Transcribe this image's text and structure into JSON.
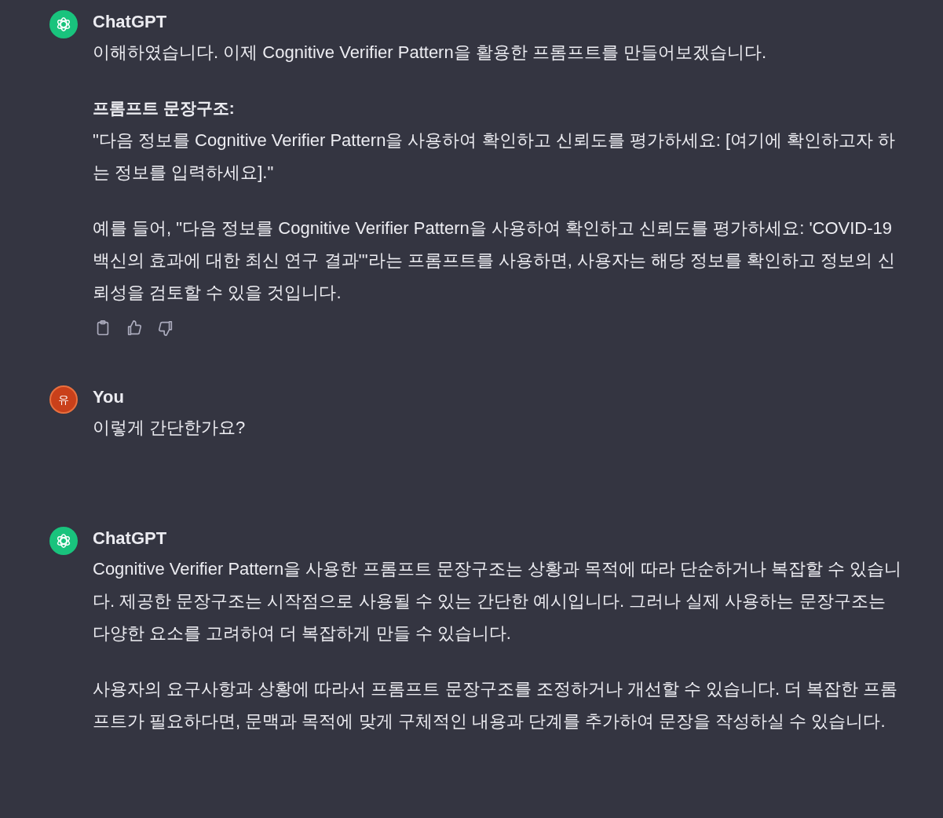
{
  "messages": [
    {
      "kind": "assistant",
      "author": "ChatGPT",
      "has_actions": true,
      "blocks": [
        {
          "kind": "paragraph",
          "text": "이해하였습니다. 이제 Cognitive Verifier Pattern을 활용한 프롬프트를 만들어보겠습니다."
        },
        {
          "kind": "heading_with_text",
          "heading": "프롬프트 문장구조:",
          "text": "\"다음 정보를 Cognitive Verifier Pattern을 사용하여 확인하고 신뢰도를 평가하세요: [여기에 확인하고자 하는 정보를 입력하세요].\""
        },
        {
          "kind": "paragraph",
          "text": "예를 들어, \"다음 정보를 Cognitive Verifier Pattern을 사용하여 확인하고 신뢰도를 평가하세요: 'COVID-19 백신의 효과에 대한 최신 연구 결과'\"라는 프롬프트를 사용하면, 사용자는 해당 정보를 확인하고 정보의 신뢰성을 검토할 수 있을 것입니다."
        }
      ]
    },
    {
      "kind": "user",
      "author": "You",
      "avatar_text": "유",
      "has_actions": false,
      "blocks": [
        {
          "kind": "paragraph",
          "text": "이렇게 간단한가요?"
        }
      ]
    },
    {
      "kind": "assistant",
      "author": "ChatGPT",
      "has_actions": false,
      "blocks": [
        {
          "kind": "paragraph",
          "text": "Cognitive Verifier Pattern을 사용한 프롬프트 문장구조는 상황과 목적에 따라 단순하거나 복잡할 수 있습니다. 제공한 문장구조는 시작점으로 사용될 수 있는 간단한 예시입니다. 그러나 실제 사용하는 문장구조는 다양한 요소를 고려하여 더 복잡하게 만들 수 있습니다."
        },
        {
          "kind": "paragraph",
          "text": "사용자의 요구사항과 상황에 따라서 프롬프트 문장구조를 조정하거나 개선할 수 있습니다. 더 복잡한 프롬프트가 필요하다면, 문맥과 목적에 맞게 구체적인 내용과 단계를 추가하여 문장을 작성하실 수 있습니다."
        }
      ]
    }
  ]
}
